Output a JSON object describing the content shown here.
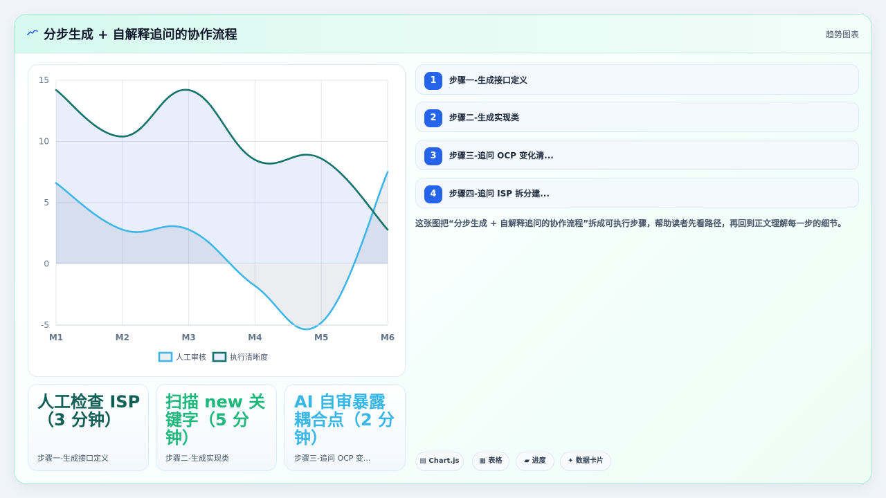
{
  "header": {
    "icon": "trend-icon",
    "title": "分步生成 + 自解释追问的协作流程",
    "right_label": "趋势图表"
  },
  "chart_data": {
    "type": "line",
    "categories": [
      "M1",
      "M2",
      "M3",
      "M4",
      "M5",
      "M6"
    ],
    "ylim": [
      -5,
      15
    ],
    "yticks": [
      -5,
      0,
      5,
      10,
      15
    ],
    "grid": true,
    "legend_position": "bottom",
    "series": [
      {
        "name": "人工审核",
        "values": [
          6.6,
          2.8,
          2.8,
          -1.8,
          -4.8,
          7.5
        ],
        "color": "#3eb6e8",
        "fill": "rgba(100,116,139,0.13)"
      },
      {
        "name": "执行清晰度",
        "values": [
          14.2,
          10.4,
          14.2,
          8.5,
          8.6,
          2.8
        ],
        "color": "#12746a",
        "fill": "rgba(129,158,236,0.18)"
      }
    ]
  },
  "steps": [
    {
      "num": "1",
      "label": "步骤一-生成接口定义"
    },
    {
      "num": "2",
      "label": "步骤二-生成实现类"
    },
    {
      "num": "3",
      "label": "步骤三-追问 OCP 变化清..."
    },
    {
      "num": "4",
      "label": "步骤四-追问 ISP 拆分建..."
    }
  ],
  "description": "这张图把“分步生成 + 自解释追问的协作流程”拆成可执行步骤，帮助读者先看路径，再回到正文理解每一步的细节。",
  "stats": [
    {
      "big": "人工检查 ISP（3 分钟）",
      "small": "步骤一-生成接口定义",
      "color": "#0f5f55"
    },
    {
      "big": "扫描 new 关键字（5 分钟）",
      "small": "步骤二-生成实现类",
      "color": "#1fb87c"
    },
    {
      "big": "AI 自审暴露耦合点（2 分钟）",
      "small": "步骤三-追问 OCP 变...",
      "color": "#38b6e8"
    }
  ],
  "chips": [
    {
      "label": "▤ Chart.js"
    },
    {
      "label": "▦ 表格"
    },
    {
      "label": "▰ 进度"
    },
    {
      "label": "✦ 数据卡片"
    }
  ]
}
